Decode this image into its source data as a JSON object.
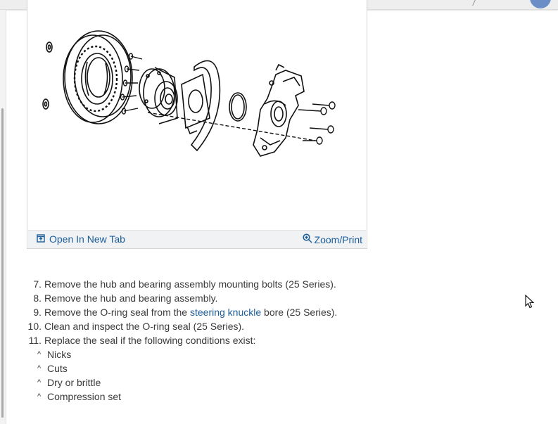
{
  "figure": {
    "open_tab_label": "Open In New Tab",
    "zoom_label": "Zoom/Print",
    "icons": {
      "open_tab": "open-new-tab-icon",
      "zoom": "zoom-in-icon"
    }
  },
  "steps": [
    {
      "num": "7.",
      "text": "Remove the hub and bearing assembly mounting bolts (25 Series)."
    },
    {
      "num": "8.",
      "text": "Remove the hub and bearing assembly."
    },
    {
      "num": "9.",
      "pre": "Remove the O-ring seal from the ",
      "link": "steering knuckle",
      "post": " bore (25 Series)."
    },
    {
      "num": "10.",
      "text": "Clean and inspect the O-ring seal (25 Series)."
    },
    {
      "num": "11.",
      "text": "Replace the seal if the following conditions exist:"
    }
  ],
  "conditions": {
    "marker": "^",
    "items": [
      "Nicks",
      "Cuts",
      "Dry or brittle",
      "Compression set"
    ]
  },
  "colors": {
    "link": "#1a5c9a",
    "text": "#3a3a3a",
    "footer_bg": "#f1f2f4",
    "avatar": "#6a8fc7"
  }
}
